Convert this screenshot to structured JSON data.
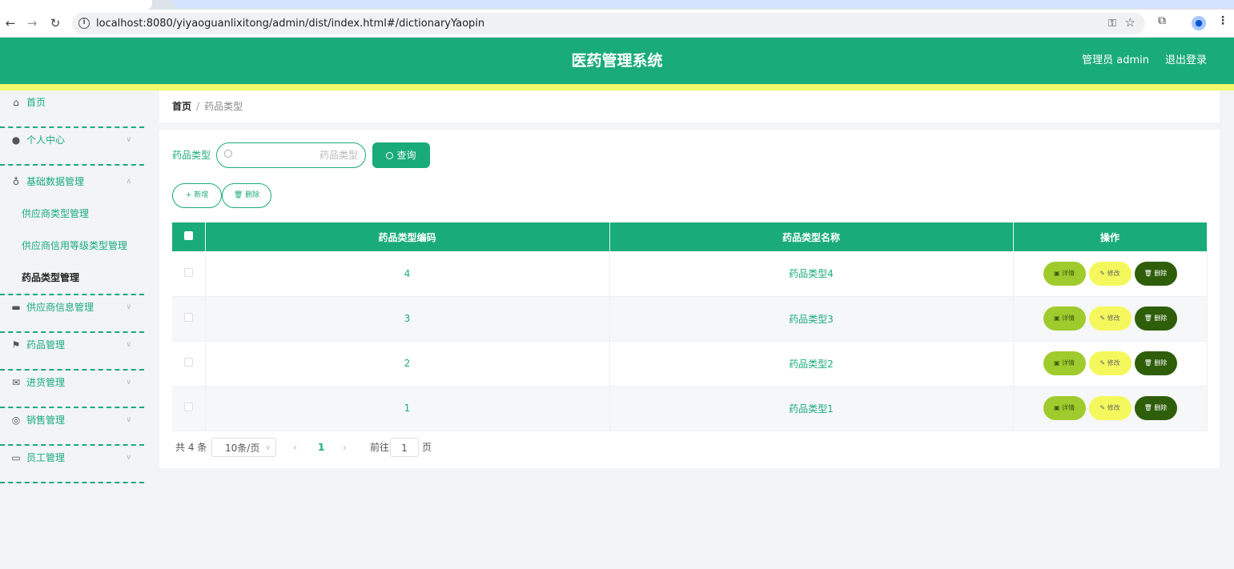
{
  "browser": {
    "url": "localhost:8080/yiyaoguanlixitong/admin/dist/index.html#/dictionaryYaopin"
  },
  "header": {
    "title": "医药管理系统",
    "user": "管理员 admin",
    "logout": "退出登录"
  },
  "sidebar": {
    "items": [
      {
        "label": "首页",
        "icon": "home-icon"
      },
      {
        "label": "个人中心",
        "icon": "user-icon"
      },
      {
        "label": "基础数据管理",
        "icon": "microphone-icon"
      },
      {
        "label": "供应商信息管理",
        "icon": "wallet-icon"
      },
      {
        "label": "药品管理",
        "icon": "flag-icon"
      },
      {
        "label": "进货管理",
        "icon": "mail-icon"
      },
      {
        "label": "销售管理",
        "icon": "help-icon"
      },
      {
        "label": "员工管理",
        "icon": "briefcase-icon"
      }
    ],
    "submenu": [
      {
        "label": "供应商类型管理"
      },
      {
        "label": "供应商信用等级类型管理"
      },
      {
        "label": "药品类型管理"
      }
    ]
  },
  "breadcrumb": {
    "home": "首页",
    "separator": "/",
    "current": "药品类型"
  },
  "search": {
    "label": "药品类型",
    "placeholder": "药品类型",
    "button": "查询"
  },
  "actions": {
    "add": "新增",
    "delete": "删除"
  },
  "table": {
    "columns": [
      "药品类型编码",
      "药品类型名称",
      "操作"
    ],
    "rows": [
      {
        "code": "4",
        "name": "药品类型4"
      },
      {
        "code": "3",
        "name": "药品类型3"
      },
      {
        "code": "2",
        "name": "药品类型2"
      },
      {
        "code": "1",
        "name": "药品类型1"
      }
    ],
    "op_labels": {
      "detail": "详情",
      "edit": "修改",
      "delete": "删除"
    }
  },
  "pagination": {
    "total": "共 4 条",
    "page_size": "10条/页",
    "current_page": "1",
    "goto_label": "前往",
    "goto_value": "1",
    "goto_unit": "页"
  },
  "colors": {
    "primary": "#1aab7b",
    "header_stripe": "#f1f96a",
    "detail_btn": "#9fcb2c",
    "edit_btn": "#f5f85c",
    "delete_btn": "#2e5e0a"
  }
}
